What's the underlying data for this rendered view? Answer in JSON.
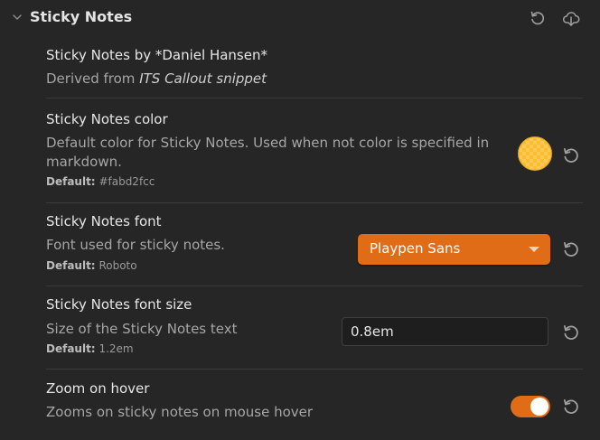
{
  "section": {
    "title": "Sticky Notes",
    "reset_icon": "reset-icon",
    "import_icon": "import-icon"
  },
  "info": {
    "name": "Sticky Notes by *Daniel Hansen*",
    "desc_prefix": "Derived from ",
    "desc_link": "ITS Callout snippet"
  },
  "color_setting": {
    "name": "Sticky Notes color",
    "desc": "Default color for Sticky Notes. Used when not color is specified in markdown.",
    "default_label": "Default:",
    "default_value": "#fabd2fcc",
    "swatch_color": "#fabd2f"
  },
  "font_setting": {
    "name": "Sticky Notes font",
    "desc": "Font used for sticky notes.",
    "default_label": "Default:",
    "default_value": "Roboto",
    "selected": "Playpen Sans"
  },
  "font_size_setting": {
    "name": "Sticky Notes font size",
    "desc": "Size of the Sticky Notes text",
    "default_label": "Default:",
    "default_value": "1.2em",
    "value": "0.8em"
  },
  "zoom_setting": {
    "name": "Zoom on hover",
    "desc": "Zooms on sticky notes on mouse hover",
    "enabled": true
  },
  "colors": {
    "accent": "#e06c17",
    "background": "#262626"
  }
}
